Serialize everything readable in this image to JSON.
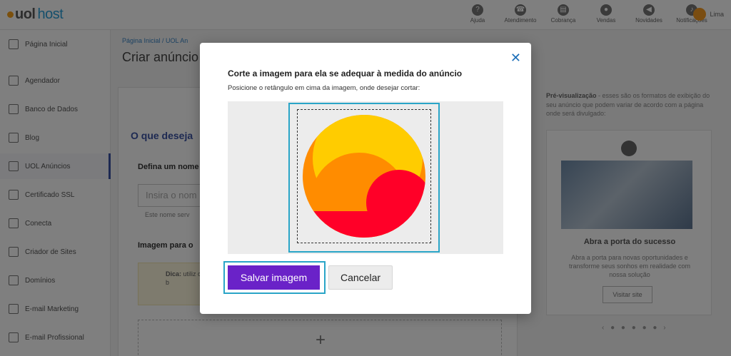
{
  "app": {
    "logo_brand": "uol",
    "logo_product": "host",
    "user_name": "Lima"
  },
  "topnav": [
    {
      "label": "Ajuda",
      "icon": "help-icon",
      "glyph": "?"
    },
    {
      "label": "Atendimento",
      "icon": "headset-icon",
      "glyph": "☎"
    },
    {
      "label": "Cobrança",
      "icon": "billing-icon",
      "glyph": "▤"
    },
    {
      "label": "Vendas",
      "icon": "chat-icon",
      "glyph": "●"
    },
    {
      "label": "Novidades",
      "icon": "megaphone-icon",
      "glyph": "◀"
    },
    {
      "label": "Notificações",
      "icon": "bell-icon",
      "glyph": "♪"
    }
  ],
  "sidebar": {
    "items": [
      {
        "label": "Página Inicial",
        "icon": "home-icon"
      },
      {
        "label": "Agendador",
        "icon": "calendar-icon"
      },
      {
        "label": "Banco de Dados",
        "icon": "database-icon"
      },
      {
        "label": "Blog",
        "icon": "pen-icon"
      },
      {
        "label": "UOL Anúncios",
        "icon": "megaphone-icon"
      },
      {
        "label": "Certificado SSL",
        "icon": "lock-icon"
      },
      {
        "label": "Conecta",
        "icon": "link-icon"
      },
      {
        "label": "Criador de Sites",
        "icon": "browser-icon"
      },
      {
        "label": "Domínios",
        "icon": "globe-icon"
      },
      {
        "label": "E-mail Marketing",
        "icon": "mail-icon"
      },
      {
        "label": "E-mail Profissional",
        "icon": "mail-pro-icon"
      }
    ]
  },
  "main": {
    "breadcrumb": "Página Inicial  /  UOL An",
    "page_title": "Criar anúncio",
    "question_title": "O que deseja",
    "name_label": "Defina um nome",
    "name_placeholder": "Insira o nom",
    "name_hint": "Este nome serv",
    "image_label": "Imagem para o",
    "tip_bold": "Dica:",
    "tip_text": "utiliz com pesso está com b"
  },
  "preview": {
    "heading_bold": "Pré-visualização",
    "heading_text": " - esses são os formatos de exibição do seu anúncio que podem variar de acordo com a página onde será divulgado:",
    "card_title": "Abra a porta do sucesso",
    "card_desc": "Abra a porta para novas oportunidades e transforme seus sonhos em realidade com nossa solução",
    "card_button": "Visitar site"
  },
  "modal": {
    "title": "Corte a imagem para ela se adequar à medida do anúncio",
    "subtitle": "Posicione o retângulo em cima da imagem, onde desejar cortar:",
    "save_label": "Salvar imagem",
    "cancel_label": "Cancelar",
    "close_glyph": "✕"
  },
  "colors": {
    "accent_purple": "#6a22c8",
    "focus_cyan": "#2aa5c7",
    "close_blue": "#1d6fb8",
    "logo_outer": "#ff8c00",
    "logo_yellow": "#ffcc00",
    "logo_red": "#ff0028"
  }
}
